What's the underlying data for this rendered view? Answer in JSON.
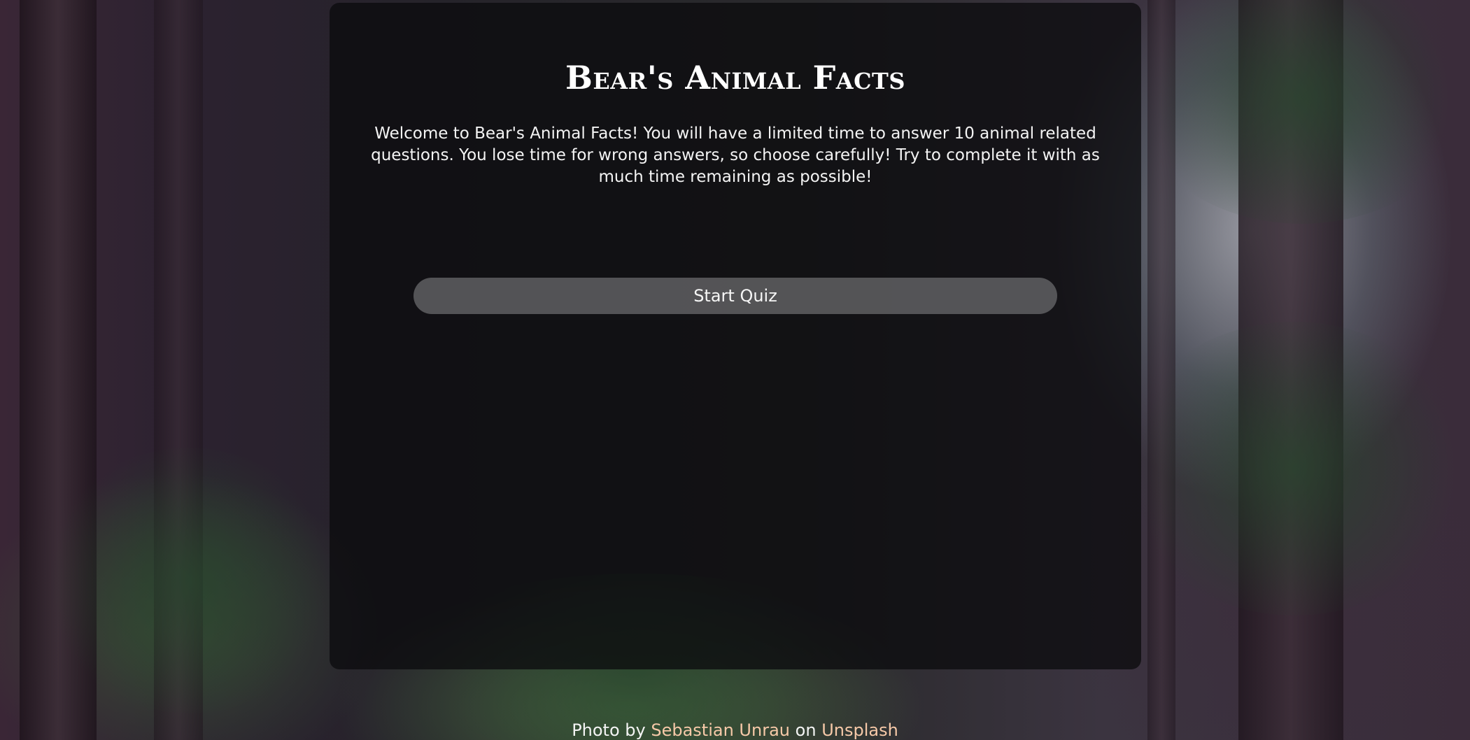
{
  "quiz": {
    "title": "Bear's Animal Facts",
    "intro": "Welcome to Bear's Animal Facts! You will have a limited time to answer 10 animal related questions. You lose time for wrong answers, so choose carefully! Try to complete it with as much time remaining as possible!",
    "start_label": "Start Quiz"
  },
  "footer": {
    "prefix": "Photo by",
    "photographer": "Sebastian Unrau",
    "middle": "on",
    "site": "Unsplash"
  },
  "colors": {
    "panel": "#0c0c0e",
    "button": "#6e6e70",
    "link": "#f6c9a8",
    "text": "#f4f4f4"
  }
}
